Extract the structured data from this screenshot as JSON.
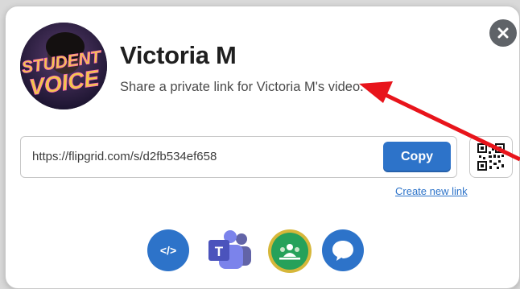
{
  "dialog": {
    "title": "Victoria M",
    "subtitle": "Share a private link for Victoria M's video.",
    "avatar_text_line1": "STUDENT",
    "avatar_text_line2": "VOICE"
  },
  "link": {
    "url": "https://flipgrid.com/s/d2fb534ef658",
    "copy_label": "Copy",
    "create_new_label": "Create new link"
  },
  "share_options": {
    "embed_label": "</>",
    "teams_label": "T"
  },
  "colors": {
    "accent": "#2d73c9",
    "arrow": "#e8141b",
    "classroom_green": "#26a15a",
    "classroom_ring": "#d6b73a"
  },
  "icons": [
    "close-icon",
    "qr-code-icon",
    "embed-code-icon",
    "microsoft-teams-icon",
    "google-classroom-icon",
    "comment-icon"
  ]
}
